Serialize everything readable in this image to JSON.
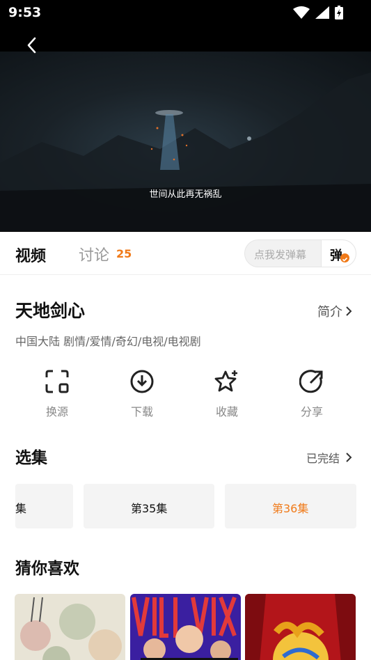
{
  "status_bar": {
    "time": "9:53"
  },
  "player": {
    "subtitle": "世间从此再无祸乱"
  },
  "tabs": {
    "video": "视频",
    "discussion": "讨论",
    "discussion_count": "25"
  },
  "danmaku": {
    "placeholder": "点我发弹幕",
    "toggle_label": "弹"
  },
  "show": {
    "title": "天地剑心",
    "intro_label": "简介",
    "tags": "中国大陆  剧情/爱情/奇幻/电视/电视剧"
  },
  "actions": [
    {
      "label": "换源",
      "icon": "switch-source-icon"
    },
    {
      "label": "下载",
      "icon": "download-icon"
    },
    {
      "label": "收藏",
      "icon": "favorite-star-icon"
    },
    {
      "label": "分享",
      "icon": "share-icon"
    }
  ],
  "episodes": {
    "section_title": "选集",
    "status": "已完结",
    "items": [
      "集",
      "第35集",
      "第36集"
    ],
    "active_index": 2
  },
  "recommend": {
    "section_title": "猜你喜欢"
  },
  "colors": {
    "accent": "#f07a19"
  }
}
